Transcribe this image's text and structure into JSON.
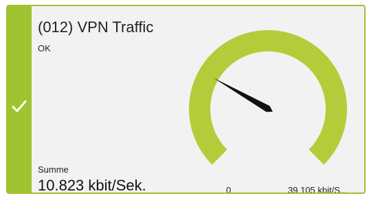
{
  "tile": {
    "title": "(012) VPN Traffic",
    "status": "OK",
    "status_icon": "check-icon",
    "metric_label": "Summe",
    "metric_value": "10.823 kbit/Sek.",
    "gauge": {
      "min_label": "0",
      "max_label": "39.105 kbit/S...",
      "min": 0,
      "max": 39.105,
      "value": 10.823,
      "unit": "kbit/Sek."
    }
  },
  "colors": {
    "accent": "#9fc42f",
    "gauge_arc": "#b5cc3a",
    "needle": "#111111",
    "tile_bg": "#f2f2f2",
    "border": "#9ec22f"
  }
}
